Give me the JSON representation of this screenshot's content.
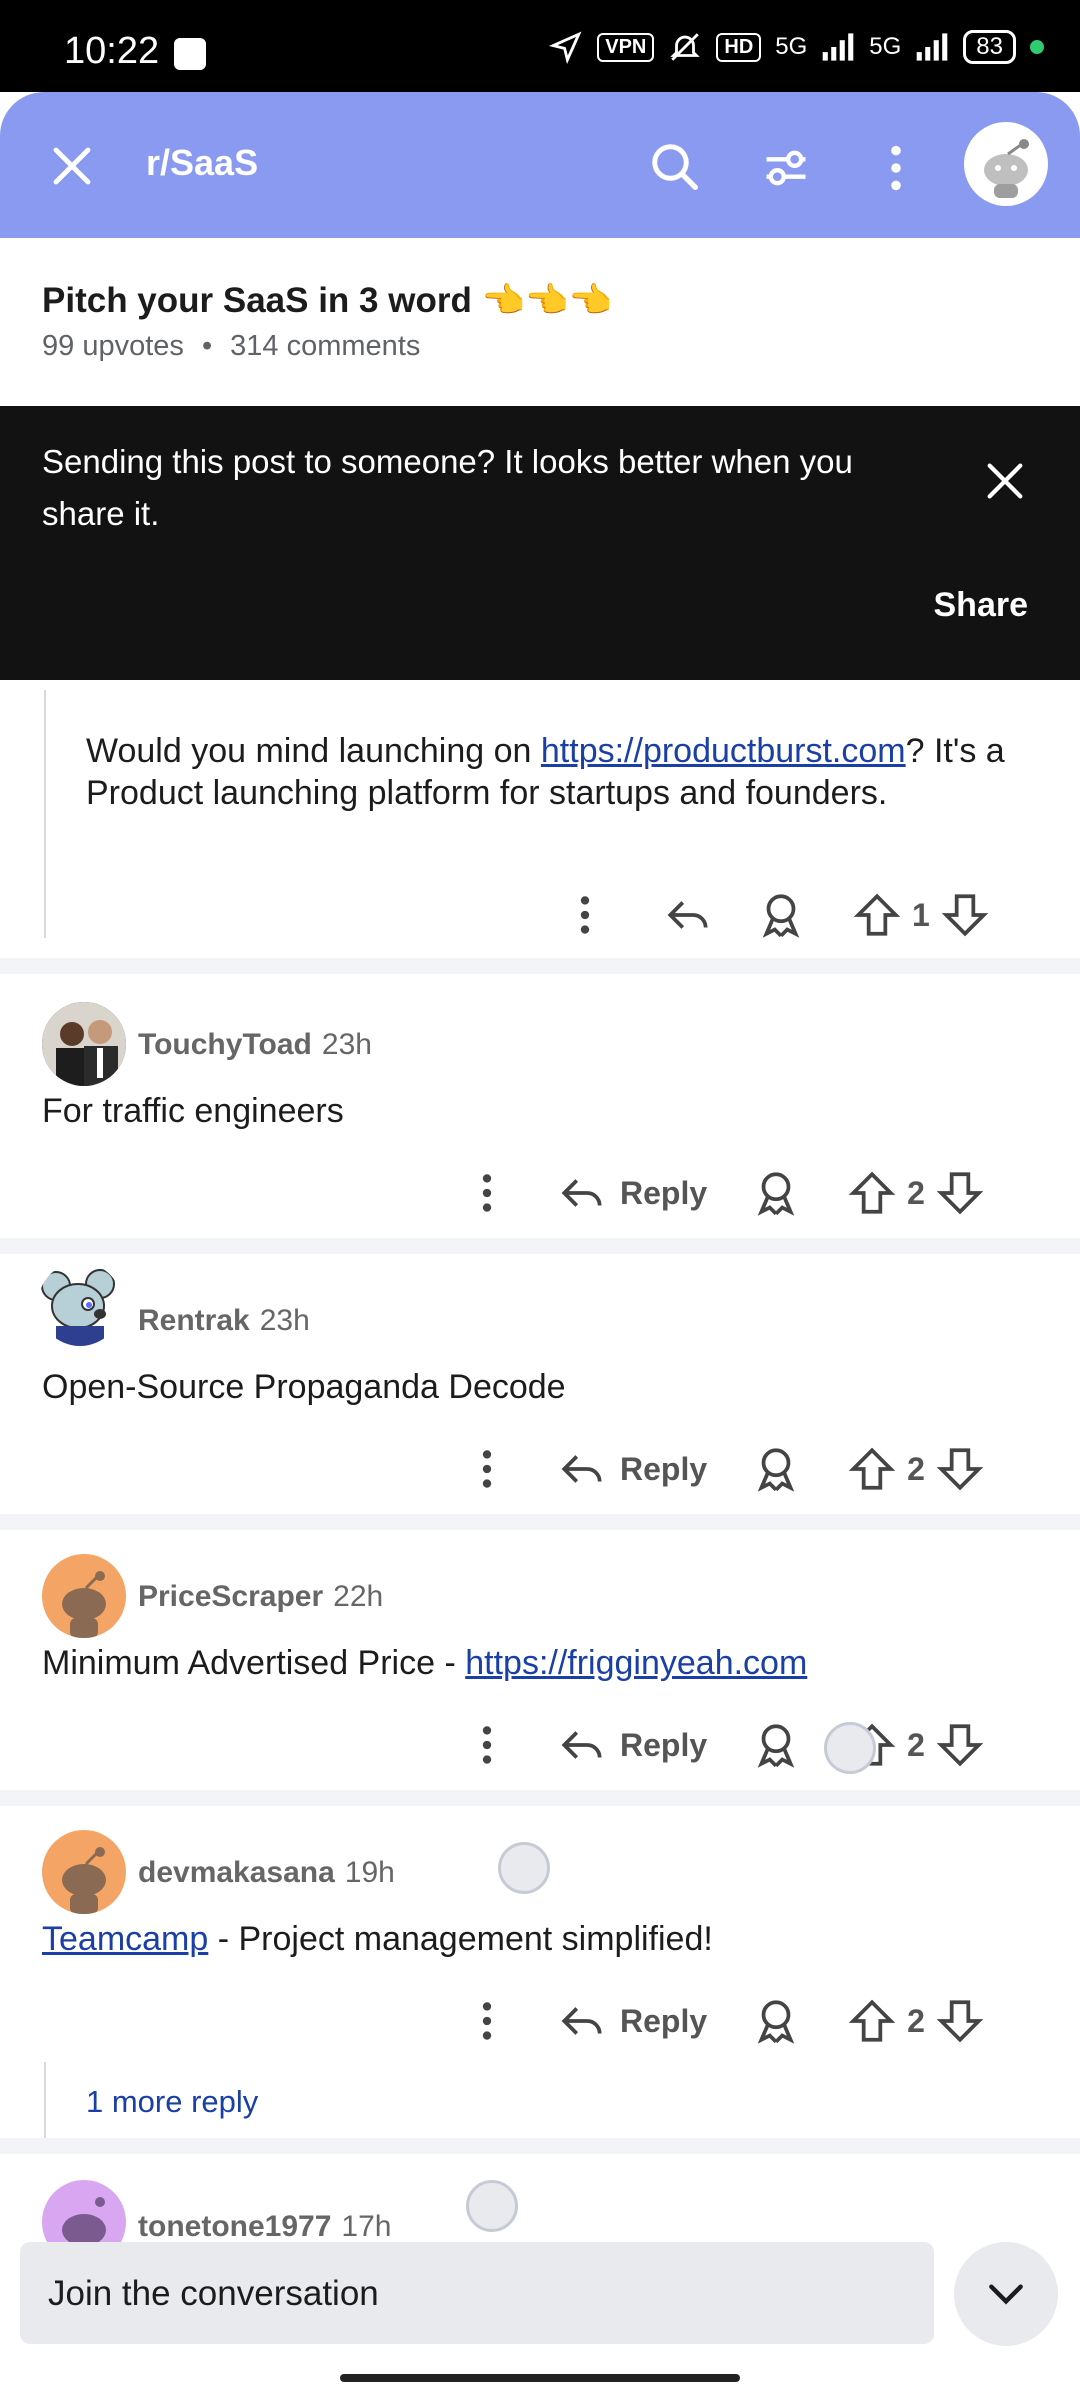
{
  "status_bar": {
    "time": "10:22",
    "vpn": "VPN",
    "hd": "HD",
    "net1": "5G",
    "net2": "5G",
    "battery": "83"
  },
  "header": {
    "subreddit": "r/SaaS"
  },
  "post": {
    "title": "Pitch your SaaS in 3 word 👈👈👈",
    "upvotes": "99 upvotes",
    "dot": "•",
    "comments": "314 comments"
  },
  "toast": {
    "message": "Sending this post to someone? It looks better when you share it.",
    "share_label": "Share"
  },
  "first_comment": {
    "text_before": "Would you mind launching on ",
    "link": "https://productburst.com",
    "text_after": "? It's a Product launching platform for startups and founders.",
    "votes": "1"
  },
  "comments": [
    {
      "user": "TouchyToad",
      "age": "23h",
      "text": "For traffic engineers",
      "votes": "2",
      "reply_label": "Reply"
    },
    {
      "user": "Rentrak",
      "age": "23h",
      "text": "Open-Source Propaganda Decode",
      "votes": "2",
      "reply_label": "Reply"
    },
    {
      "user": "PriceScraper",
      "age": "22h",
      "text_before": "Minimum Advertised Price - ",
      "link": "https://frigginyeah.com",
      "votes": "2",
      "reply_label": "Reply"
    },
    {
      "user": "devmakasana",
      "age": "19h",
      "link": "Teamcamp",
      "text_after": " - Project management simplified!",
      "votes": "2",
      "reply_label": "Reply",
      "more_replies": "1 more reply"
    },
    {
      "user": "tonetone1977",
      "age": "17h"
    }
  ],
  "composer": {
    "placeholder": "Join the conversation"
  },
  "colors": {
    "header": "#8a9af0",
    "toast": "#121212",
    "link": "#1a3fa6"
  }
}
